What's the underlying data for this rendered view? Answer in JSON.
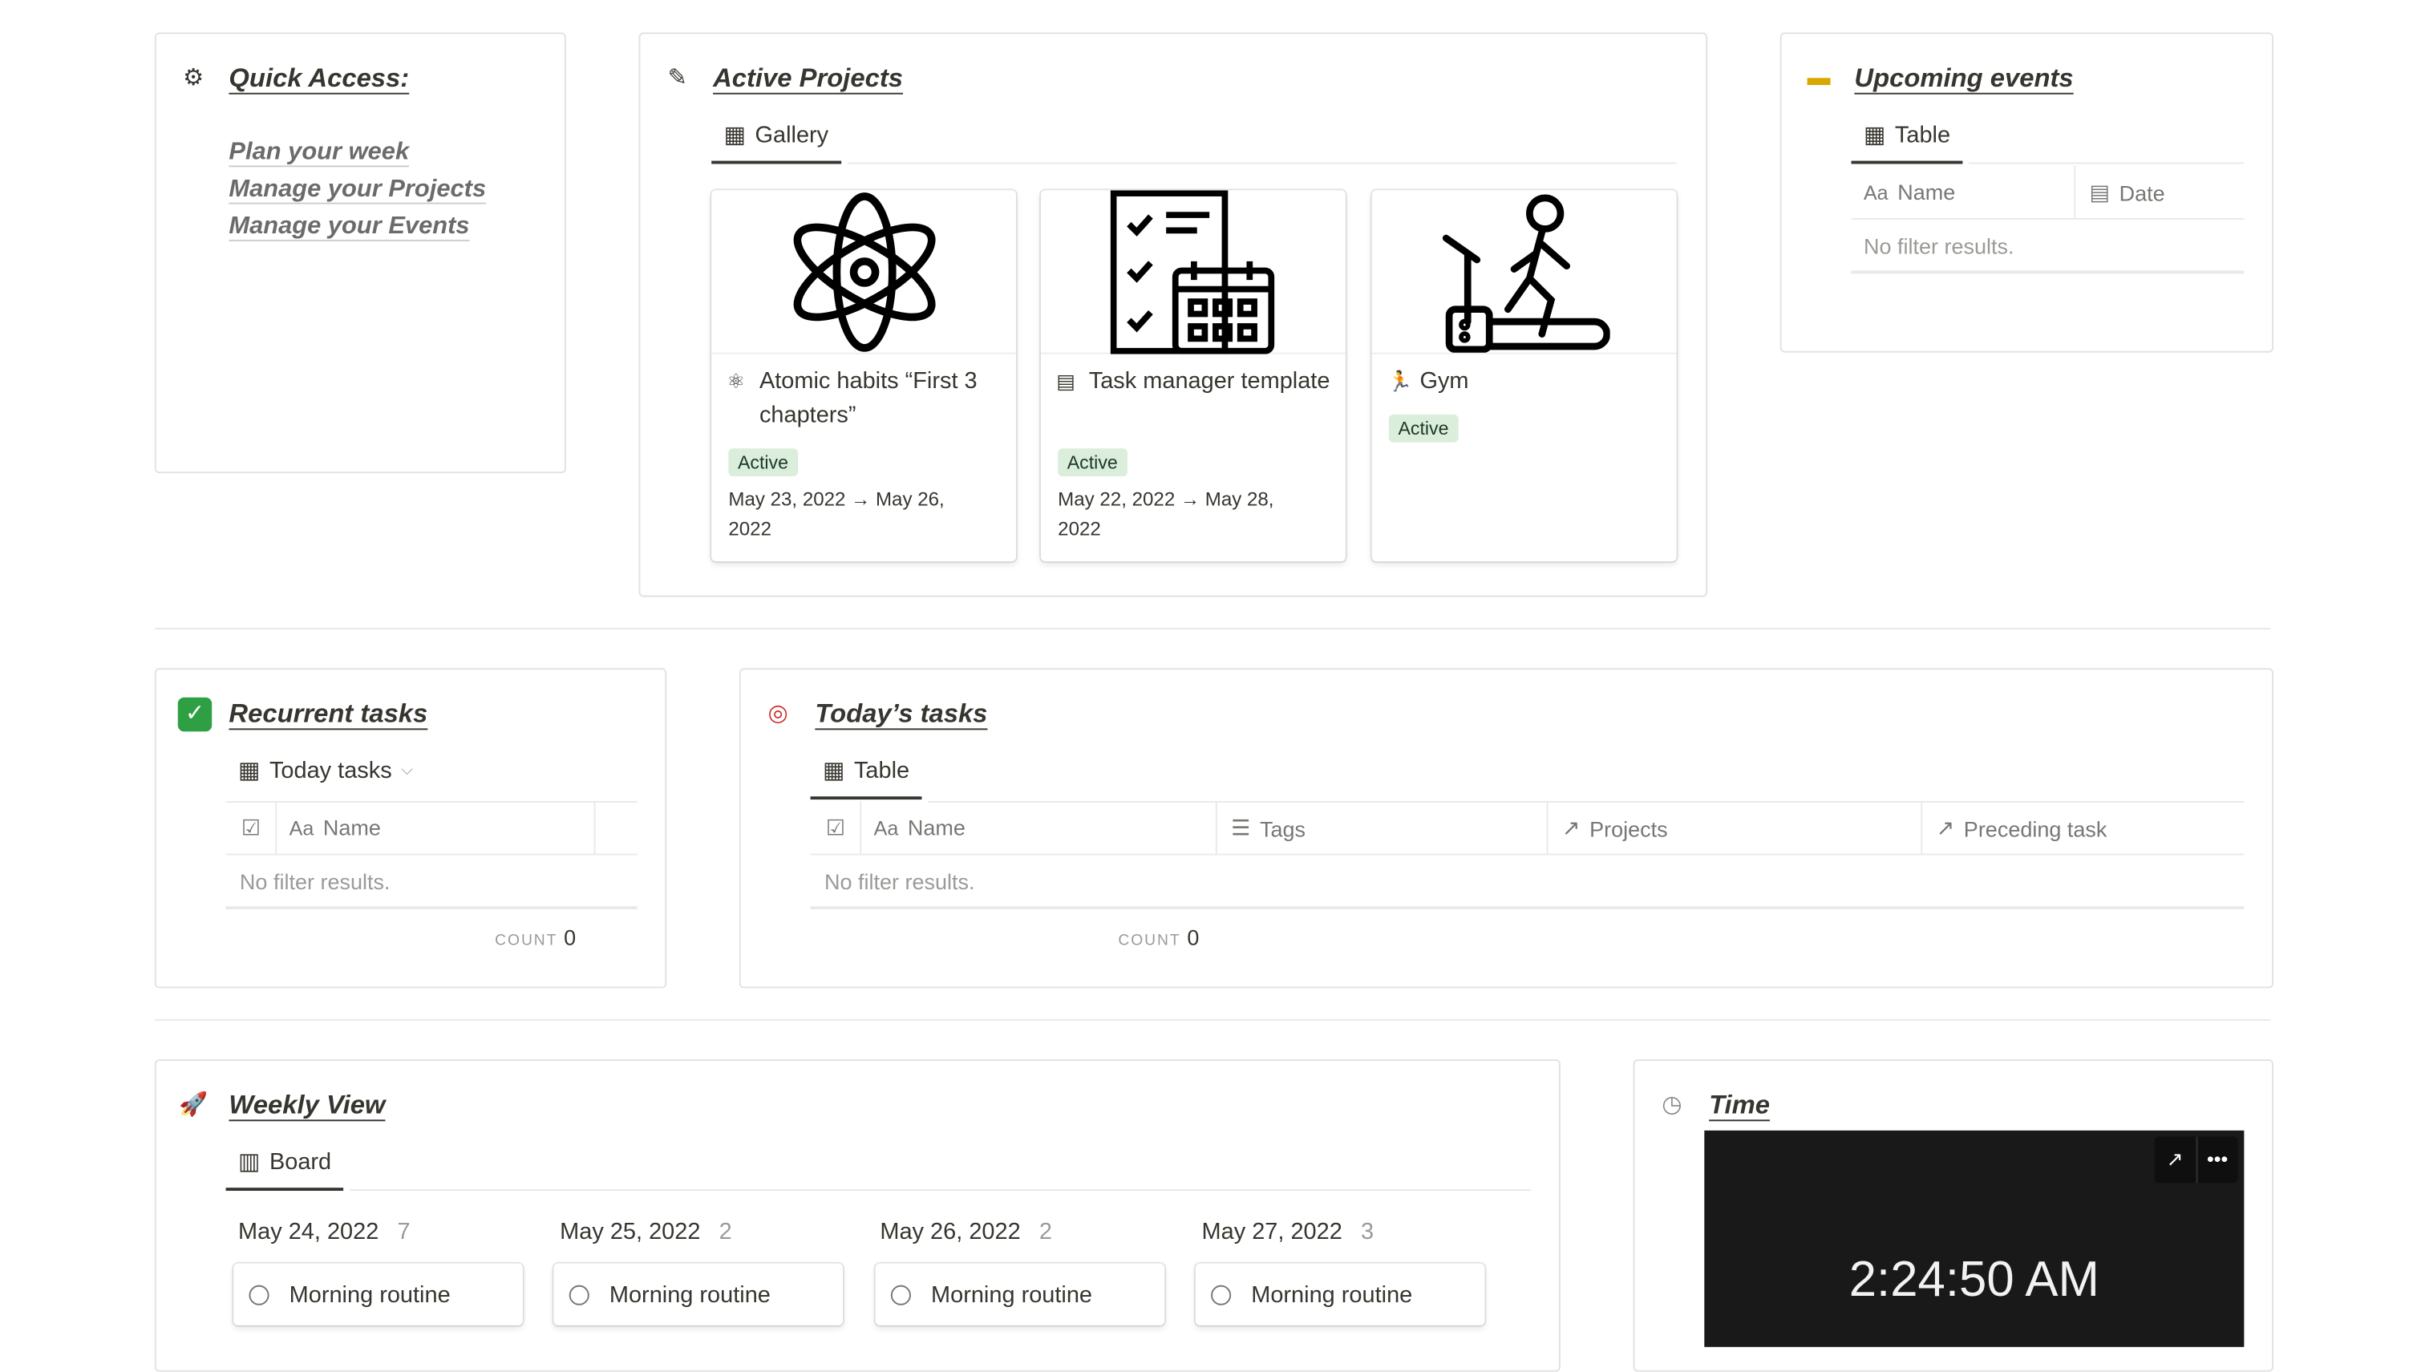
{
  "quick_access": {
    "title": "Quick Access:",
    "icon": "gear-icon",
    "links": [
      "Plan your week",
      "Manage your Projects",
      "Manage your Events"
    ]
  },
  "active_projects": {
    "title": "Active Projects",
    "icon": "memo-icon",
    "view": "Gallery",
    "cards": [
      {
        "title": "Atomic habits “First 3 chapters”",
        "icon": "atom-icon",
        "status": "Active",
        "date": "May 23, 2022 → May 26, 2022"
      },
      {
        "title": "Task manager template",
        "icon": "checklist-calendar-icon",
        "status": "Active",
        "date": "May 22, 2022 → May 28, 2022"
      },
      {
        "title": "Gym",
        "icon": "treadmill-icon",
        "status": "Active",
        "date": ""
      }
    ]
  },
  "upcoming_events": {
    "title": "Upcoming events",
    "icon": "ticket-icon",
    "view": "Table",
    "columns": [
      "Name",
      "Date"
    ],
    "empty": "No filter results."
  },
  "recurrent_tasks": {
    "title": "Recurrent tasks",
    "icon": "check-mark-icon",
    "view": "Today tasks",
    "columns": [
      "Name"
    ],
    "empty": "No filter results.",
    "count_label": "COUNT",
    "count": "0"
  },
  "todays_tasks": {
    "title": "Today’s tasks",
    "icon": "target-icon",
    "view": "Table",
    "columns": [
      "Name",
      "Tags",
      "Projects",
      "Preceding task"
    ],
    "empty": "No filter results.",
    "count_label": "COUNT",
    "count": "0"
  },
  "weekly_view": {
    "title": "Weekly View",
    "icon": "rocket-icon",
    "view": "Board",
    "columns": [
      {
        "date": "May 24, 2022",
        "count": "7",
        "card": "Morning routine"
      },
      {
        "date": "May 25, 2022",
        "count": "2",
        "card": "Morning routine"
      },
      {
        "date": "May 26, 2022",
        "count": "2",
        "card": "Morning routine"
      },
      {
        "date": "May 27, 2022",
        "count": "3",
        "card": "Morning routine"
      }
    ]
  },
  "time": {
    "title": "Time",
    "icon": "clock-icon",
    "clock": "2:24:50 AM"
  },
  "colors": {
    "badge_bg": "#dbeddb",
    "embed_bg": "#191919",
    "check_green": "#2ea043"
  }
}
